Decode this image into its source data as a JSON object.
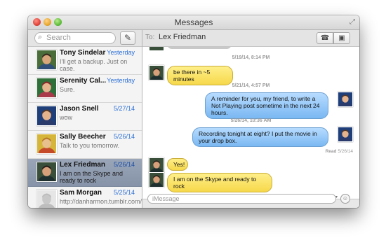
{
  "window": {
    "title": "Messages"
  },
  "sidebar": {
    "search_placeholder": "Search",
    "conversations": [
      {
        "name": "Tony Sindelar",
        "date": "Yesterday",
        "preview": "I'll get a backup. Just on case.",
        "avatar": {
          "bg": "#4a6d3a",
          "skin": "#d8a67a",
          "hair": "#3a2a1e",
          "shirt": "#2f4f7a"
        }
      },
      {
        "name": "Serenity Cal...",
        "date": "Yesterday",
        "preview": "Sure.",
        "avatar": {
          "bg": "#2f6f3a",
          "skin": "#e6b58f",
          "hair": "#8a2a2a",
          "shirt": "#aa3a4a"
        }
      },
      {
        "name": "Jason Snell",
        "date": "5/27/14",
        "preview": "wow",
        "avatar": {
          "bg": "#1f3f7a",
          "skin": "#e6b48c",
          "hair": "#5a3a22",
          "shirt": "#2a3a6a"
        }
      },
      {
        "name": "Sally Beecher",
        "date": "5/26/14",
        "preview": "Talk to you tomorrow.",
        "avatar": {
          "bg": "#d6b63a",
          "skin": "#e8c08e",
          "hair": "#b87a2a",
          "shirt": "#c44a2a"
        }
      },
      {
        "name": "Lex Friedman",
        "date": "5/26/14",
        "preview": "I am on the Skype and ready to rock",
        "selected": true,
        "avatar": {
          "bg": "#3a4f3a",
          "skin": "#d8a07a",
          "hair": "#2a1f18",
          "shirt": "#1f2f2f"
        }
      },
      {
        "name": "Sam Morgan",
        "date": "5/25/14",
        "preview": "http://danharmon.tumblr.com/po...",
        "avatar": {
          "bg": "#e6e6e6",
          "skin": "#c8c8c8",
          "hair": "#bdbdbd",
          "shirt": "#bdbdbd"
        }
      }
    ]
  },
  "header": {
    "to_label": "To:",
    "recipient": "Lex Friedman"
  },
  "transcript": {
    "items": [
      {
        "kind": "timestamp",
        "text": "5/19/14, 8:14 PM"
      },
      {
        "kind": "in",
        "text": "be there in ~5 minutes"
      },
      {
        "kind": "timestamp",
        "text": "5/21/14, 4:57 PM"
      },
      {
        "kind": "out",
        "text": "A reminder for you, my friend, to write a Not Playing post sometime in the next 24 hours."
      },
      {
        "kind": "timestamp",
        "text": "5/26/14, 10:36 AM"
      },
      {
        "kind": "out",
        "text": "Recording tonight at eight? I put the movie in your drop box."
      },
      {
        "kind": "receipt",
        "label": "Read",
        "time": "5/26/14"
      },
      {
        "kind": "in",
        "text": "Yes!"
      },
      {
        "kind": "in",
        "text": "I am on the Skype and ready to rock"
      }
    ]
  },
  "composer": {
    "placeholder": "iMessage"
  },
  "colors": {
    "incoming_bubble": "#f6d84a",
    "outgoing_bubble": "#7ab8f2",
    "date_link": "#2c6fd6",
    "selected_row": "#8f9bb0"
  },
  "icons": {
    "search": "search-icon",
    "compose": "compose-icon",
    "phone": "phone-icon",
    "video": "video-camera-icon",
    "emoji": "emoji-icon"
  }
}
